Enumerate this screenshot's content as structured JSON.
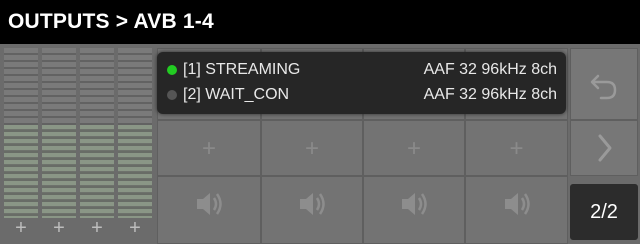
{
  "header": {
    "title": "OUTPUTS > AVB 1-4"
  },
  "colors": {
    "status_active": "#22cc22",
    "status_inactive": "#555555"
  },
  "popup": {
    "streams": [
      {
        "status": "active",
        "name": "[1] STREAMING",
        "format": "AAF 32 96kHz 8ch"
      },
      {
        "status": "inactive",
        "name": "[2] WAIT_CON",
        "format": "AAF 32 96kHz 8ch"
      }
    ]
  },
  "meters": {
    "channels": [
      {
        "add_label": "+"
      },
      {
        "add_label": "+"
      },
      {
        "add_label": "+"
      },
      {
        "add_label": "+"
      }
    ]
  },
  "grid": {
    "add_labels": [
      "+",
      "+",
      "+",
      "+"
    ],
    "mute_icons": [
      "speaker-icon",
      "speaker-icon",
      "speaker-icon",
      "speaker-icon"
    ]
  },
  "side": {
    "back_icon": "undo-arrow-icon",
    "next_icon": "chevron-right-icon",
    "page_label": "2/2"
  }
}
